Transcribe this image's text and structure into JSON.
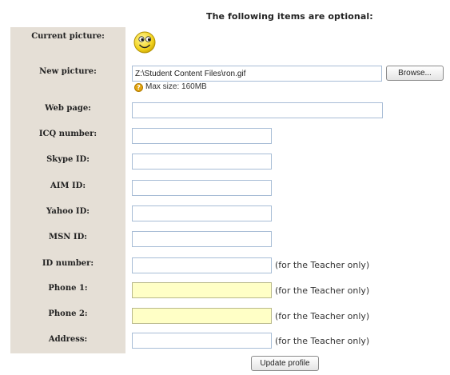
{
  "heading": "The following items are optional:",
  "labels": {
    "current_picture": "Current picture:",
    "new_picture": "New picture:",
    "web_page": "Web page:",
    "icq": "ICQ number:",
    "skype": "Skype ID:",
    "aim": "AIM ID:",
    "yahoo": "Yahoo ID:",
    "msn": "MSN ID:",
    "id_number": "ID number:",
    "phone1": "Phone 1:",
    "phone2": "Phone 2:",
    "address": "Address:"
  },
  "fields": {
    "new_picture_value": "Z:\\Student Content Files\\ron.gif",
    "web_page_value": "",
    "icq_value": "",
    "skype_value": "",
    "aim_value": "",
    "yahoo_value": "",
    "msn_value": "",
    "id_number_value": "",
    "phone1_value": "",
    "phone2_value": "",
    "address_value": ""
  },
  "browse_label": "Browse...",
  "max_size_text": "Max size: 160MB",
  "help_icon_glyph": "?",
  "teacher_note": "(for the Teacher only)",
  "update_label": "Update profile",
  "colors": {
    "label_column_bg": "#e5dfd6",
    "highlight_field_bg": "#ffffc6",
    "field_border": "#a8bdd6"
  },
  "icons": {
    "avatar": "smiley-face-icon",
    "help": "help-icon"
  }
}
